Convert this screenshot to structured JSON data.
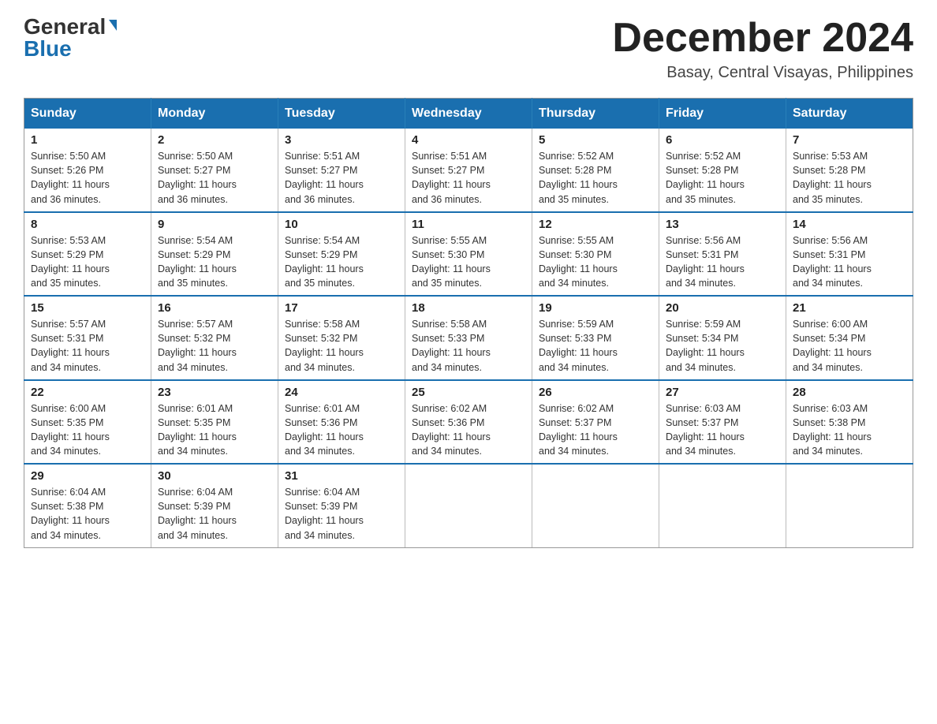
{
  "header": {
    "logo_general": "General",
    "logo_blue": "Blue",
    "month_title": "December 2024",
    "location": "Basay, Central Visayas, Philippines"
  },
  "days_of_week": [
    "Sunday",
    "Monday",
    "Tuesday",
    "Wednesday",
    "Thursday",
    "Friday",
    "Saturday"
  ],
  "weeks": [
    [
      {
        "day": "1",
        "sunrise": "5:50 AM",
        "sunset": "5:26 PM",
        "daylight": "11 hours and 36 minutes."
      },
      {
        "day": "2",
        "sunrise": "5:50 AM",
        "sunset": "5:27 PM",
        "daylight": "11 hours and 36 minutes."
      },
      {
        "day": "3",
        "sunrise": "5:51 AM",
        "sunset": "5:27 PM",
        "daylight": "11 hours and 36 minutes."
      },
      {
        "day": "4",
        "sunrise": "5:51 AM",
        "sunset": "5:27 PM",
        "daylight": "11 hours and 36 minutes."
      },
      {
        "day": "5",
        "sunrise": "5:52 AM",
        "sunset": "5:28 PM",
        "daylight": "11 hours and 35 minutes."
      },
      {
        "day": "6",
        "sunrise": "5:52 AM",
        "sunset": "5:28 PM",
        "daylight": "11 hours and 35 minutes."
      },
      {
        "day": "7",
        "sunrise": "5:53 AM",
        "sunset": "5:28 PM",
        "daylight": "11 hours and 35 minutes."
      }
    ],
    [
      {
        "day": "8",
        "sunrise": "5:53 AM",
        "sunset": "5:29 PM",
        "daylight": "11 hours and 35 minutes."
      },
      {
        "day": "9",
        "sunrise": "5:54 AM",
        "sunset": "5:29 PM",
        "daylight": "11 hours and 35 minutes."
      },
      {
        "day": "10",
        "sunrise": "5:54 AM",
        "sunset": "5:29 PM",
        "daylight": "11 hours and 35 minutes."
      },
      {
        "day": "11",
        "sunrise": "5:55 AM",
        "sunset": "5:30 PM",
        "daylight": "11 hours and 35 minutes."
      },
      {
        "day": "12",
        "sunrise": "5:55 AM",
        "sunset": "5:30 PM",
        "daylight": "11 hours and 34 minutes."
      },
      {
        "day": "13",
        "sunrise": "5:56 AM",
        "sunset": "5:31 PM",
        "daylight": "11 hours and 34 minutes."
      },
      {
        "day": "14",
        "sunrise": "5:56 AM",
        "sunset": "5:31 PM",
        "daylight": "11 hours and 34 minutes."
      }
    ],
    [
      {
        "day": "15",
        "sunrise": "5:57 AM",
        "sunset": "5:31 PM",
        "daylight": "11 hours and 34 minutes."
      },
      {
        "day": "16",
        "sunrise": "5:57 AM",
        "sunset": "5:32 PM",
        "daylight": "11 hours and 34 minutes."
      },
      {
        "day": "17",
        "sunrise": "5:58 AM",
        "sunset": "5:32 PM",
        "daylight": "11 hours and 34 minutes."
      },
      {
        "day": "18",
        "sunrise": "5:58 AM",
        "sunset": "5:33 PM",
        "daylight": "11 hours and 34 minutes."
      },
      {
        "day": "19",
        "sunrise": "5:59 AM",
        "sunset": "5:33 PM",
        "daylight": "11 hours and 34 minutes."
      },
      {
        "day": "20",
        "sunrise": "5:59 AM",
        "sunset": "5:34 PM",
        "daylight": "11 hours and 34 minutes."
      },
      {
        "day": "21",
        "sunrise": "6:00 AM",
        "sunset": "5:34 PM",
        "daylight": "11 hours and 34 minutes."
      }
    ],
    [
      {
        "day": "22",
        "sunrise": "6:00 AM",
        "sunset": "5:35 PM",
        "daylight": "11 hours and 34 minutes."
      },
      {
        "day": "23",
        "sunrise": "6:01 AM",
        "sunset": "5:35 PM",
        "daylight": "11 hours and 34 minutes."
      },
      {
        "day": "24",
        "sunrise": "6:01 AM",
        "sunset": "5:36 PM",
        "daylight": "11 hours and 34 minutes."
      },
      {
        "day": "25",
        "sunrise": "6:02 AM",
        "sunset": "5:36 PM",
        "daylight": "11 hours and 34 minutes."
      },
      {
        "day": "26",
        "sunrise": "6:02 AM",
        "sunset": "5:37 PM",
        "daylight": "11 hours and 34 minutes."
      },
      {
        "day": "27",
        "sunrise": "6:03 AM",
        "sunset": "5:37 PM",
        "daylight": "11 hours and 34 minutes."
      },
      {
        "day": "28",
        "sunrise": "6:03 AM",
        "sunset": "5:38 PM",
        "daylight": "11 hours and 34 minutes."
      }
    ],
    [
      {
        "day": "29",
        "sunrise": "6:04 AM",
        "sunset": "5:38 PM",
        "daylight": "11 hours and 34 minutes."
      },
      {
        "day": "30",
        "sunrise": "6:04 AM",
        "sunset": "5:39 PM",
        "daylight": "11 hours and 34 minutes."
      },
      {
        "day": "31",
        "sunrise": "6:04 AM",
        "sunset": "5:39 PM",
        "daylight": "11 hours and 34 minutes."
      },
      null,
      null,
      null,
      null
    ]
  ],
  "labels": {
    "sunrise": "Sunrise:",
    "sunset": "Sunset:",
    "daylight": "Daylight:"
  }
}
